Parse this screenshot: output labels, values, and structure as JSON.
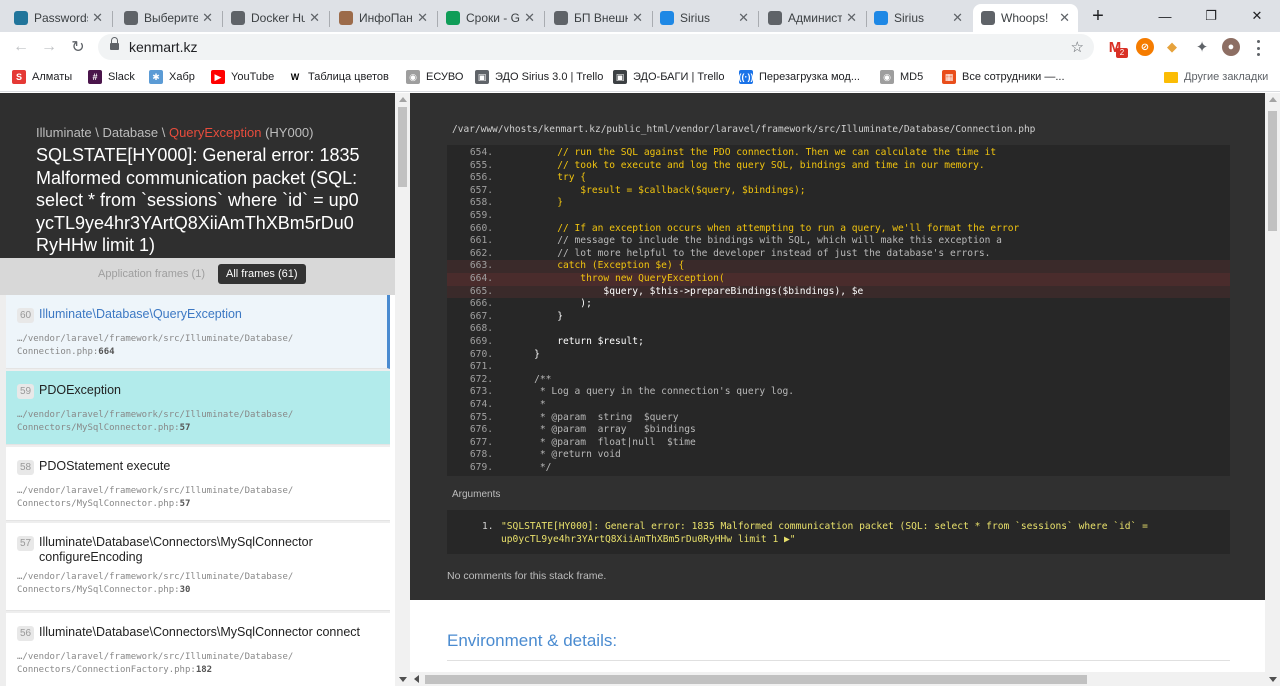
{
  "tabs": [
    {
      "title": "Passwords",
      "icon": "wordpress-icon",
      "color": "#21759b"
    },
    {
      "title": "Выберите",
      "icon": "globe-icon",
      "color": "#5f6368"
    },
    {
      "title": "Docker Hub",
      "icon": "globe-icon",
      "color": "#5f6368"
    },
    {
      "title": "ИнфоПанель",
      "icon": "avatar-icon",
      "color": "#9c6b4a"
    },
    {
      "title": "Сроки - Google Таблицы",
      "icon": "sheets-icon",
      "color": "#0f9d58"
    },
    {
      "title": "БП Внешние",
      "icon": "smiley-icon",
      "color": "#5f6368"
    },
    {
      "title": "Sirius",
      "icon": "jira-icon",
      "color": "#1e88e5"
    },
    {
      "title": "Администрирование",
      "icon": "globe-icon",
      "color": "#5f6368"
    },
    {
      "title": "Sirius",
      "icon": "jira-icon",
      "color": "#1e88e5"
    },
    {
      "title": "Whoops!",
      "icon": "globe-icon",
      "color": "#5f6368",
      "active": true
    }
  ],
  "window": {
    "minimize": "—",
    "maximize": "❐",
    "close": "✕",
    "new_tab": "+"
  },
  "toolbar": {
    "back": "←",
    "forward": "→",
    "reload": "↻",
    "url": "kenmart.kz",
    "gmail_badge": "2"
  },
  "bookmarks": [
    {
      "label": "Алматы",
      "color": "#e53935",
      "glyph": "S"
    },
    {
      "label": "Slack",
      "color": "#4a154b",
      "glyph": "#"
    },
    {
      "label": "Хабр",
      "color": "#5b9bd5",
      "glyph": "✱"
    },
    {
      "label": "YouTube",
      "color": "#ff0000",
      "glyph": "▶"
    },
    {
      "label": "Таблица цветов",
      "color": "#ffffff",
      "glyph": "W"
    },
    {
      "label": "ЕСУВО",
      "color": "#9e9e9e",
      "glyph": "◉"
    },
    {
      "label": "ЭДО Sirius 3.0 | Trello",
      "color": "#5f6368",
      "glyph": "▣"
    },
    {
      "label": "ЭДО-БАГИ | Trello",
      "color": "#3c4043",
      "glyph": "▣"
    },
    {
      "label": "Перезагрузка мод...",
      "color": "#1a73e8",
      "glyph": "((·))"
    },
    {
      "label": "MD5",
      "color": "#9e9e9e",
      "glyph": "◉"
    },
    {
      "label": "Все сотрудники —...",
      "color": "#e94e1b",
      "glyph": "▦"
    },
    {
      "label": "Другие закладки",
      "color": "#fbbc04",
      "glyph": ""
    }
  ],
  "exception": {
    "namespace_prefix": "Illuminate \\ Database \\ ",
    "class_name": "QueryException",
    "code": " (HY000)",
    "message": "SQLSTATE[HY000]: General error: 1835 Malformed communication packet (SQL: select * from `sessions` where `id` = up0ycTL9ye4hr3YArtQ8XiiAmThXBm5rDu0RyHHw limit 1)"
  },
  "frames_filter": {
    "app": "Application frames (1)",
    "all": "All frames (61)"
  },
  "frames": [
    {
      "num": "60",
      "name": "Illuminate\\Database\\QueryException",
      "path": "…/vendor/laravel/framework/src/Illuminate/Database/",
      "file": "Connection.php",
      "line": "664"
    },
    {
      "num": "59",
      "name": "PDOException",
      "path": "…/vendor/laravel/framework/src/Illuminate/Database/",
      "file": "Connectors/MySqlConnector.php",
      "line": "57"
    },
    {
      "num": "58",
      "name": "PDOStatement execute",
      "path": "…/vendor/laravel/framework/src/Illuminate/Database/",
      "file": "Connectors/MySqlConnector.php",
      "line": "57"
    },
    {
      "num": "57",
      "name": "Illuminate\\Database\\Connectors\\MySqlConnector configureEncoding",
      "path": "…/vendor/laravel/framework/src/Illuminate/Database/",
      "file": "Connectors/MySqlConnector.php",
      "line": "30"
    },
    {
      "num": "56",
      "name": "Illuminate\\Database\\Connectors\\MySqlConnector connect",
      "path": "…/vendor/laravel/framework/src/Illuminate/Database/",
      "file": "Connectors/ConnectionFactory.php",
      "line": "182"
    }
  ],
  "code": {
    "file_path": "/var/www/vhosts/kenmart.kz/public_html/vendor/laravel/framework/src/Illuminate/Database/Connection.php",
    "lines": [
      {
        "n": "654.",
        "t": "        // run the SQL against the PDO connection. Then we can calculate the time it",
        "cls": "c"
      },
      {
        "n": "655.",
        "t": "        // took to execute and log the query SQL, bindings and time in our memory.",
        "cls": "c"
      },
      {
        "n": "656.",
        "t": "        try {",
        "cls": "c"
      },
      {
        "n": "657.",
        "t": "            $result = $callback($query, $bindings);",
        "cls": "c"
      },
      {
        "n": "658.",
        "t": "        }",
        "cls": "c"
      },
      {
        "n": "659.",
        "t": "",
        "cls": "c"
      },
      {
        "n": "660.",
        "t": "        // If an exception occurs when attempting to run a query, we'll format the error",
        "cls": "c"
      },
      {
        "n": "661.",
        "t": "        // message to include the bindings with SQL, which will make this exception a",
        "cls": "cm"
      },
      {
        "n": "662.",
        "t": "        // lot more helpful to the developer instead of just the database's errors.",
        "cls": "cm"
      },
      {
        "n": "663.",
        "t": "        catch (Exception $e) {",
        "cls": "c",
        "hl": "hl"
      },
      {
        "n": "664.",
        "t": "            throw new QueryException(",
        "cls": "c",
        "hl": "hl2"
      },
      {
        "n": "665.",
        "t": "                $query, $this->prepareBindings($bindings), $e",
        "cls": "v",
        "hl": "hl"
      },
      {
        "n": "666.",
        "t": "            );",
        "cls": "v"
      },
      {
        "n": "667.",
        "t": "        }",
        "cls": "v"
      },
      {
        "n": "668.",
        "t": "",
        "cls": "v"
      },
      {
        "n": "669.",
        "t": "        return $result;",
        "cls": "v"
      },
      {
        "n": "670.",
        "t": "    }",
        "cls": "v"
      },
      {
        "n": "671.",
        "t": "",
        "cls": "v"
      },
      {
        "n": "672.",
        "t": "    /**",
        "cls": "cm"
      },
      {
        "n": "673.",
        "t": "     * Log a query in the connection's query log.",
        "cls": "cm"
      },
      {
        "n": "674.",
        "t": "     *",
        "cls": "cm"
      },
      {
        "n": "675.",
        "t": "     * @param  string  $query",
        "cls": "cm"
      },
      {
        "n": "676.",
        "t": "     * @param  array   $bindings",
        "cls": "cm"
      },
      {
        "n": "677.",
        "t": "     * @param  float|null  $time",
        "cls": "cm"
      },
      {
        "n": "678.",
        "t": "     * @return void",
        "cls": "cm"
      },
      {
        "n": "679.",
        "t": "     */",
        "cls": "cm"
      }
    ]
  },
  "arguments": {
    "label": "Arguments",
    "items": [
      {
        "num": "1.",
        "text": "\"SQLSTATE[HY000]: General error: 1835 Malformed communication packet (SQL: select * from `sessions` where `id` = up0ycTL9ye4hr3YArtQ8XiiAmThXBm5rDu0RyHHw limit 1 ▶\""
      }
    ]
  },
  "no_comments": "No comments for this stack frame.",
  "environment_title": "Environment & details:"
}
